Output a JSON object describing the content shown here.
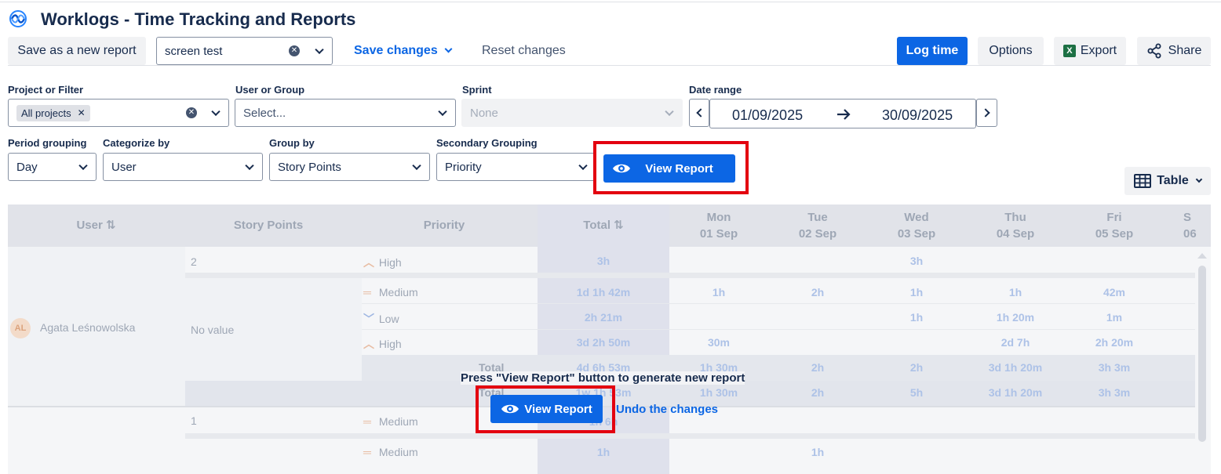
{
  "header": {
    "title": "Worklogs - Time Tracking and Reports"
  },
  "toolbar": {
    "save_new": "Save as a new report",
    "report_name": "screen test",
    "save_changes": "Save changes",
    "reset_changes": "Reset changes",
    "log_time": "Log time",
    "options": "Options",
    "export": "Export",
    "share": "Share"
  },
  "filters": {
    "project_label": "Project or Filter",
    "project_tag": "All projects",
    "user_label": "User or Group",
    "user_placeholder": "Select...",
    "sprint_label": "Sprint",
    "sprint_value": "None",
    "date_label": "Date range",
    "date_from": "01/09/2025",
    "date_to": "30/09/2025",
    "period_label": "Period grouping",
    "period_value": "Day",
    "categorize_label": "Categorize by",
    "categorize_value": "User",
    "group_label": "Group by",
    "group_value": "Story Points",
    "secondary_label": "Secondary Grouping",
    "secondary_value": "Priority",
    "view_report": "View Report",
    "view_mode": "Table"
  },
  "table": {
    "headers": {
      "user": "User",
      "story_points": "Story Points",
      "priority": "Priority",
      "total": "Total"
    },
    "days": [
      {
        "dow": "Mon",
        "date": "01 Sep"
      },
      {
        "dow": "Tue",
        "date": "02 Sep"
      },
      {
        "dow": "Wed",
        "date": "03 Sep"
      },
      {
        "dow": "Thu",
        "date": "04 Sep"
      },
      {
        "dow": "Fri",
        "date": "05 Sep"
      },
      {
        "dow": "S",
        "date": "06"
      }
    ],
    "user_name": "Agata Leśnowolska",
    "user_initials": "AL",
    "sp_2": "2",
    "sp_novalue": "No value",
    "sp_1": "1",
    "rows": [
      {
        "priority": "High",
        "total": "3h",
        "wed": "3h"
      },
      {
        "priority": "Medium",
        "total": "1d 1h 42m",
        "mon": "1h",
        "tue": "2h",
        "wed": "1h",
        "thu": "1h",
        "fri": "42m"
      },
      {
        "priority": "Low",
        "total": "2h 21m",
        "wed": "1h",
        "thu": "1h 20m",
        "fri": "1m"
      },
      {
        "priority": "High",
        "total": "3d 2h 50m",
        "mon": "30m",
        "thu": "2d 7h",
        "fri": "2h 20m"
      },
      {
        "label": "Total",
        "total": "4d 6h 53m",
        "mon": "1h 30m",
        "tue": "2h",
        "wed": "2h",
        "thu": "3d 1h 20m",
        "fri": "3h 3m"
      },
      {
        "label": "Total",
        "total": "1w 1h 53m",
        "mon": "1h 30m",
        "tue": "2h",
        "wed": "5h",
        "thu": "3d 1h 20m",
        "fri": "3h 3m"
      },
      {
        "priority": "Medium",
        "total": "1h 6h"
      },
      {
        "priority": "Medium",
        "total": "1h",
        "tue": "1h"
      }
    ]
  },
  "notice": {
    "message": "Press \"View Report\" button to generate new report",
    "view_report": "View Report",
    "undo": "Undo the changes"
  }
}
